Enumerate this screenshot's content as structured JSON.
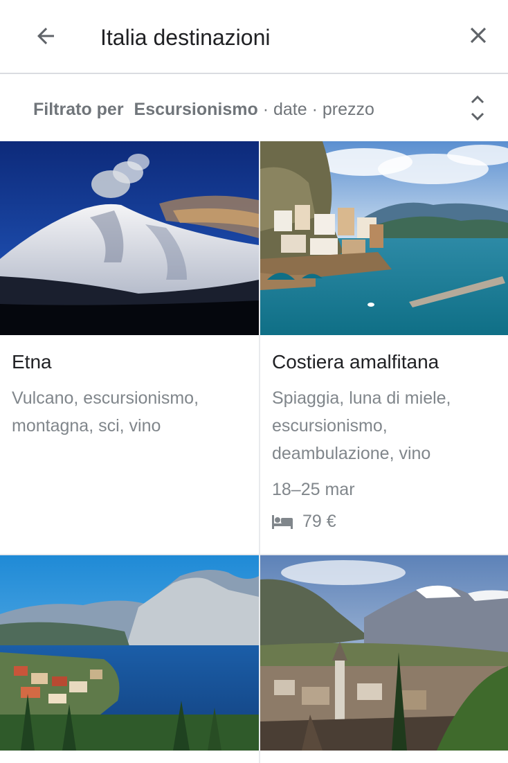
{
  "header": {
    "search_query": "Italia destinazioni",
    "back_icon": "arrow-back-icon",
    "close_icon": "close-icon"
  },
  "filter": {
    "label": "Filtrato per",
    "active": "Escursionismo",
    "options_text": " · date · prezzo",
    "sort_icon": "unfold-more-icon"
  },
  "cards": [
    {
      "title": "Etna",
      "tags": "Vulcano, escursionismo, montagna, sci, vino",
      "image": "volcano-snow-photo"
    },
    {
      "title": "Costiera amalfitana",
      "tags": "Spiaggia, luna di miele, escursionismo, deambulazione, vino",
      "dates": "18–25 mar",
      "price": "79 €",
      "price_icon": "hotel-bed-icon",
      "image": "coastline-photo"
    },
    {
      "image": "lake-mountains-photo"
    },
    {
      "image": "valley-town-photo"
    }
  ]
}
